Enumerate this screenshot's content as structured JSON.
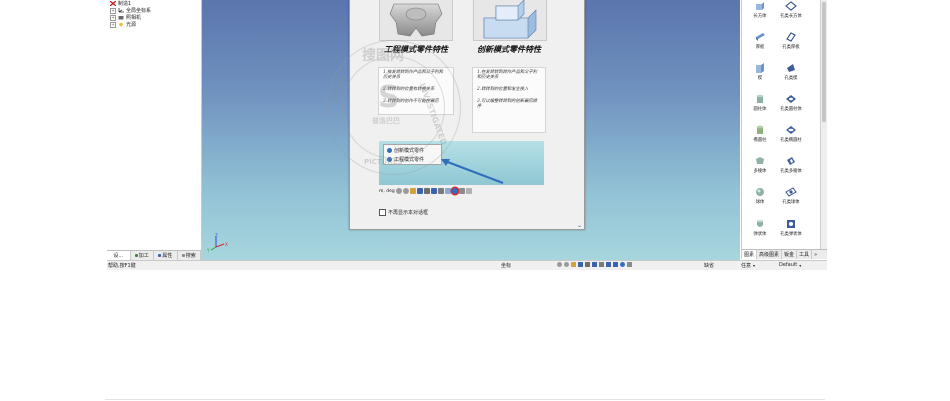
{
  "tree": {
    "items": [
      {
        "label": "制造1",
        "icon": "part-icon"
      },
      {
        "label": "全局坐标系",
        "icon": "coordinate-system-icon"
      },
      {
        "label": "照相机",
        "icon": "camera-icon"
      },
      {
        "label": "光源",
        "icon": "light-icon"
      }
    ]
  },
  "left_tabs": [
    {
      "label": "设..."
    },
    {
      "label": "加工"
    },
    {
      "label": "属性"
    },
    {
      "label": "搜索"
    }
  ],
  "axis_labels": {
    "z": "Z",
    "x": "X",
    "y": "Y"
  },
  "dialog": {
    "engineering_heading": "工程模式零件特性",
    "innovation_heading": "创新模式零件特性",
    "engineering_points": [
      "1.按发转转到作产品和父子利和历史关系",
      "2.转转到的位置有转换关系",
      "3.转转到的创作不可能在最后"
    ],
    "innovation_points": [
      "1.在发转转到转作产品和父子利和历史关系",
      "2.转转到的位置和发生接入",
      "3.可以编整转转到的创新最后顺序"
    ],
    "popup_items": [
      {
        "label": "创新模式零件"
      },
      {
        "label": "工程模式零件"
      }
    ],
    "toolbar_label": "m, deg",
    "dont_show_label": "不再显示本对话框",
    "scroll_glyph": "⌄"
  },
  "watermark": {
    "top_text": "搜图网",
    "left_text": "STEAL",
    "right_text": "INVESTIGATED",
    "bottom_text": "PICTURES",
    "center_text": "S",
    "brand_text": "普洛巴巴"
  },
  "palette": {
    "items": [
      {
        "label": "长方体",
        "icon": "box-icon"
      },
      {
        "label": "孔类长方体",
        "icon": "box-hole-icon"
      },
      {
        "label": "厚板",
        "icon": "thick-plate-icon"
      },
      {
        "label": "孔类厚板",
        "icon": "plate-hole-icon"
      },
      {
        "label": "楔",
        "icon": "wedge-icon"
      },
      {
        "label": "孔类楔",
        "icon": "wedge-hole-icon"
      },
      {
        "label": "圆柱体",
        "icon": "cylinder-icon"
      },
      {
        "label": "孔类圆柱体",
        "icon": "cylinder-hole-icon"
      },
      {
        "label": "椭圆柱",
        "icon": "elliptic-cylinder-icon"
      },
      {
        "label": "孔类椭圆柱",
        "icon": "elliptic-hole-icon"
      },
      {
        "label": "多棱体",
        "icon": "polyhedron-icon"
      },
      {
        "label": "孔类多棱体",
        "icon": "polyhedron-hole-icon"
      },
      {
        "label": "球体",
        "icon": "sphere-icon"
      },
      {
        "label": "孔类球体",
        "icon": "sphere-hole-icon"
      },
      {
        "label": "弹状体",
        "icon": "capsule-icon"
      },
      {
        "label": "孔类弹状体",
        "icon": "capsule-hole-icon"
      }
    ],
    "tabs": [
      {
        "label": "图素"
      },
      {
        "label": "高级图素"
      },
      {
        "label": "钣金"
      },
      {
        "label": "工具"
      }
    ],
    "more_glyph": "»"
  },
  "status": {
    "help_text": "帮助,按F1键",
    "coord_label": "坐标",
    "snap_label": "缺省",
    "filter_label": "任意",
    "default_label": "Default"
  },
  "colors": {
    "accent_blue": "#2f6fbd",
    "highlight_red": "#d9262b"
  }
}
